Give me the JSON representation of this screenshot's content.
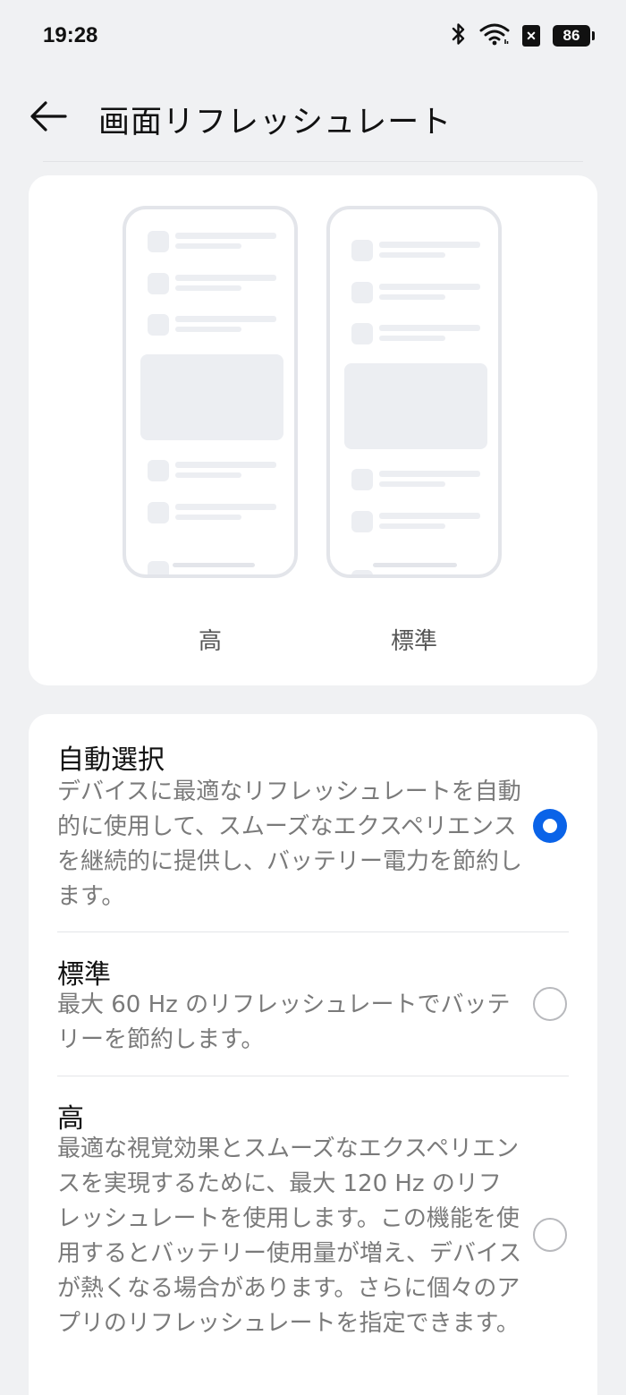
{
  "status_bar": {
    "time": "19:28",
    "battery_level": "86",
    "icons": [
      "bluetooth-icon",
      "wifi-icon",
      "no-sim-icon",
      "battery-icon"
    ]
  },
  "header": {
    "title": "画面リフレッシュレート",
    "back_icon": "arrow-left-icon"
  },
  "preview": {
    "high_label": "高",
    "standard_label": "標準"
  },
  "options": [
    {
      "title": "自動選択",
      "description": "デバイスに最適なリフレッシュレートを自動的に使用して、スムーズなエクスペリエンスを継続的に提供し、バッテリー電力を節約します。",
      "selected": true
    },
    {
      "title": "標準",
      "description": "最大 60 Hz のリフレッシュレートでバッテリーを節約します。",
      "selected": false
    },
    {
      "title": "高",
      "description": "最適な視覚効果とスムーズなエクスペリエンスを実現するために、最大 120 Hz のリフレッシュレートを使用します。この機能を使用するとバッテリー使用量が増え、デバイスが熱くなる場合があります。さらに個々のアプリのリフレッシュレートを指定できます。",
      "selected": false
    }
  ],
  "colors": {
    "accent": "#0a63e8",
    "background": "#f0f1f3",
    "card": "#ffffff"
  }
}
